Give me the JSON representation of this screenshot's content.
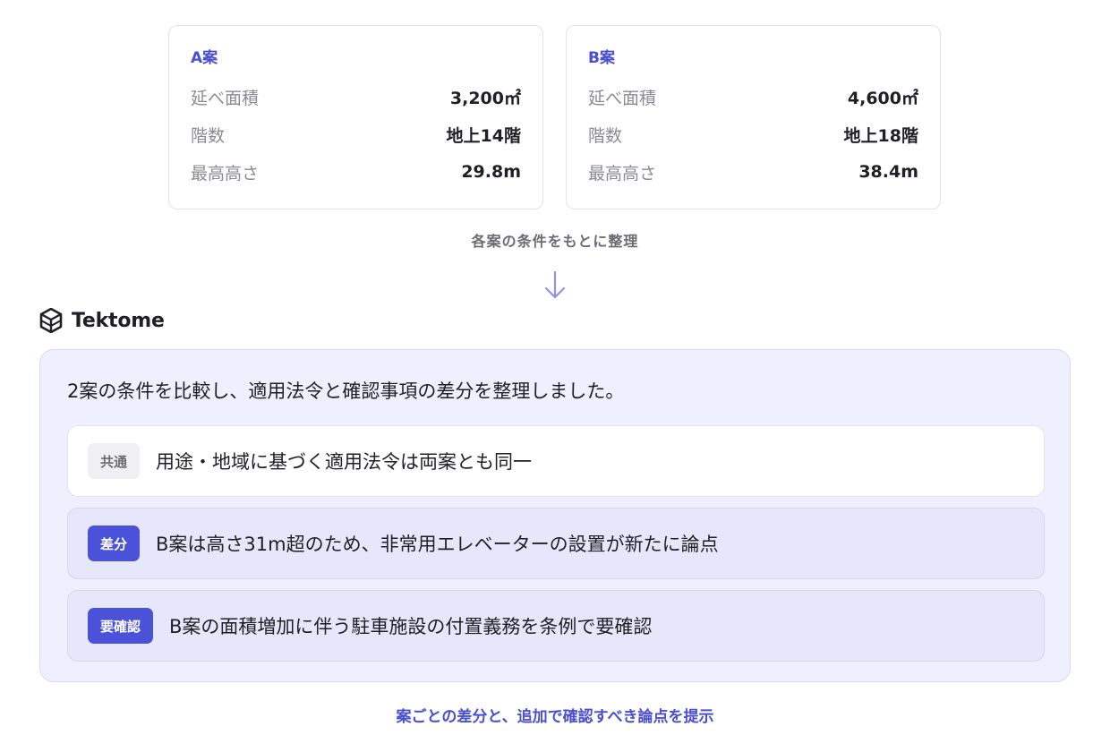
{
  "plans": [
    {
      "title": "A案",
      "specs": [
        {
          "label": "延べ面積",
          "value": "3,200㎡"
        },
        {
          "label": "階数",
          "value": "地上14階"
        },
        {
          "label": "最高高さ",
          "value": "29.8m"
        }
      ]
    },
    {
      "title": "B案",
      "specs": [
        {
          "label": "延べ面積",
          "value": "4,600㎡"
        },
        {
          "label": "階数",
          "value": "地上18階"
        },
        {
          "label": "最高高さ",
          "value": "38.4m"
        }
      ]
    }
  ],
  "caption_top": "各案の条件をもとに整理",
  "brand": {
    "name": "Tektome",
    "icon": "tektome-logo-icon"
  },
  "response": {
    "summary": "2案の条件を比較し、適用法令と確認事項の差分を整理しました。",
    "findings": [
      {
        "tag": "共通",
        "text": "用途・地域に基づく適用法令は両案とも同一"
      },
      {
        "tag": "差分",
        "text": "B案は高さ31m超のため、非常用エレベーターの設置が新たに論点"
      },
      {
        "tag": "要確認",
        "text": "B案の面積増加に伴う駐車施設の付置義務を条例で要確認"
      }
    ]
  },
  "caption_bottom": "案ごとの差分と、追加で確認すべき論点を提示",
  "colors": {
    "accent": "#4a4ed1",
    "panel_bg": "#eef0fd",
    "tag_blue": "#4a52d9",
    "tag_gray_bg": "#f0f0f2"
  }
}
